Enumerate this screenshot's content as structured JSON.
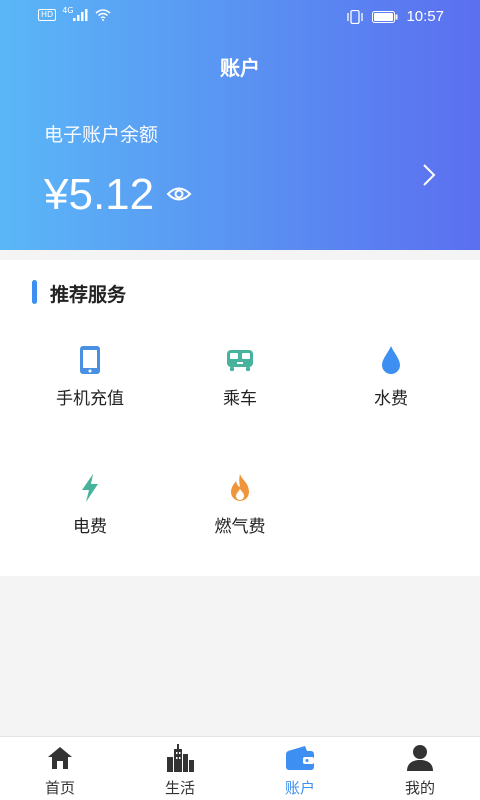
{
  "status_bar": {
    "network_badge": "HD",
    "network_type": "4G",
    "time": "10:57"
  },
  "page": {
    "title": "账户"
  },
  "account": {
    "balance_label": "电子账户余额",
    "balance": "¥5.12"
  },
  "services": {
    "title": "推荐服务",
    "items": [
      {
        "label": "手机充值",
        "icon": "phone-icon",
        "color": "#4a90e2"
      },
      {
        "label": "乘车",
        "icon": "bus-icon",
        "color": "#47b39c"
      },
      {
        "label": "水费",
        "icon": "water-drop-icon",
        "color": "#3d8ff2"
      },
      {
        "label": "电费",
        "icon": "lightning-icon",
        "color": "#47b39c"
      },
      {
        "label": "燃气费",
        "icon": "flame-icon",
        "color": "#f0963a"
      }
    ]
  },
  "tabbar": {
    "items": [
      {
        "label": "首页",
        "icon": "home-icon",
        "active": false
      },
      {
        "label": "生活",
        "icon": "city-icon",
        "active": false
      },
      {
        "label": "账户",
        "icon": "wallet-icon",
        "active": true
      },
      {
        "label": "我的",
        "icon": "user-icon",
        "active": false
      }
    ]
  },
  "colors": {
    "accent": "#3d8ff2",
    "header_start": "#5ab7f7",
    "header_end": "#5b6ff0"
  }
}
